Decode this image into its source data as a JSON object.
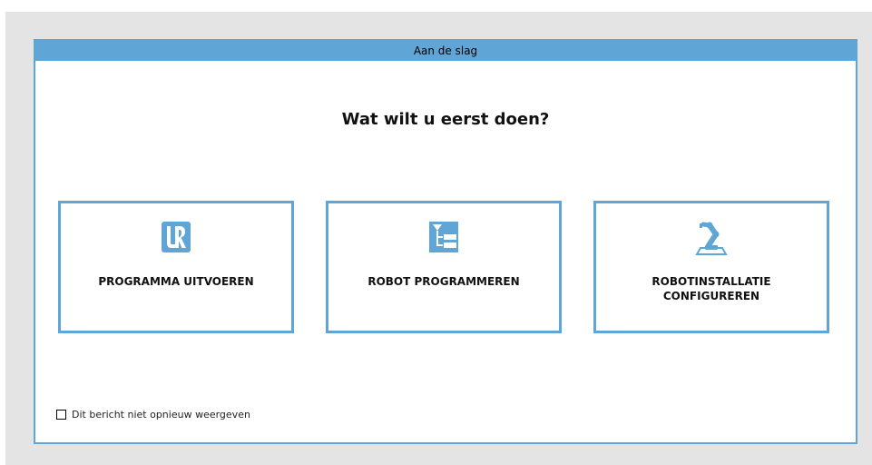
{
  "dialog": {
    "title": "Aan de slag",
    "heading": "Wat wilt u eerst doen?"
  },
  "cards": [
    {
      "label_lines": [
        "PROGRAMMA UITVOEREN"
      ],
      "icon": "ur-logo-icon"
    },
    {
      "label_lines": [
        "ROBOT PROGRAMMEREN"
      ],
      "icon": "program-tree-icon"
    },
    {
      "label_lines": [
        "ROBOTINSTALLATIE",
        "CONFIGUREREN"
      ],
      "icon": "robot-arm-icon"
    }
  ],
  "footer": {
    "dont_show_label": "Dit bericht niet opnieuw weergeven",
    "dont_show_checked": false
  },
  "colors": {
    "accent": "#5fa5d6",
    "backdrop": "#e4e4e4"
  }
}
